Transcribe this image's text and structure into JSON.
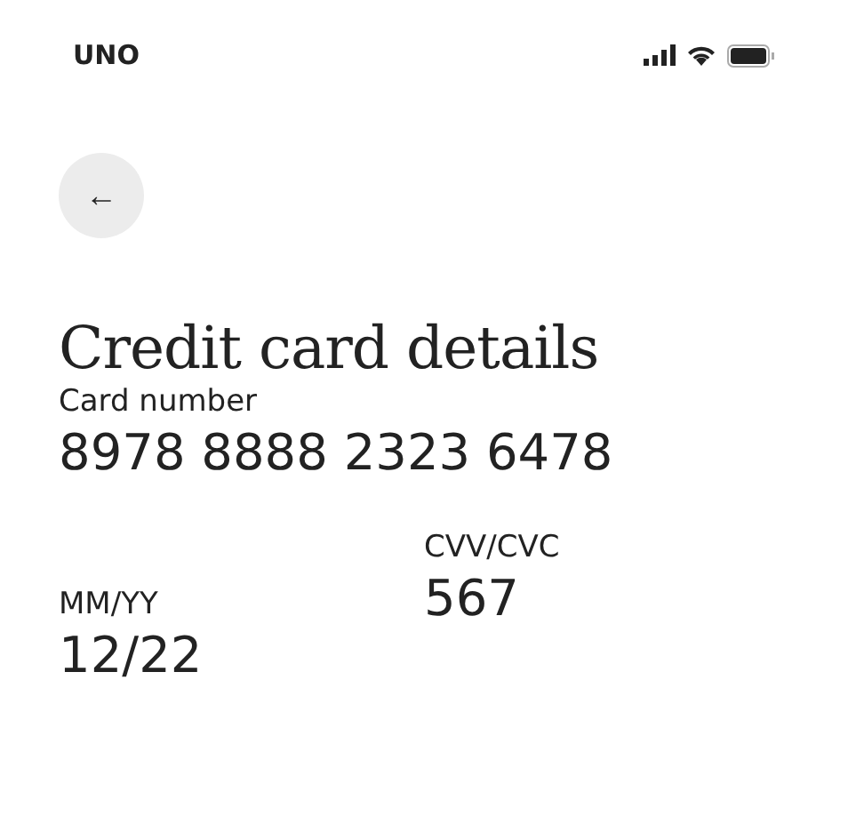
{
  "status_bar": {
    "carrier": "UNO"
  },
  "back_button": {
    "label": "←"
  },
  "title": "Credit card details",
  "card_number": {
    "label": "Card number",
    "value": "8978 8888 2323 6478"
  },
  "fields": [
    {
      "label": "MM/YY",
      "value": "12/22"
    },
    {
      "label": "CVV/CVC",
      "value": "567"
    }
  ]
}
